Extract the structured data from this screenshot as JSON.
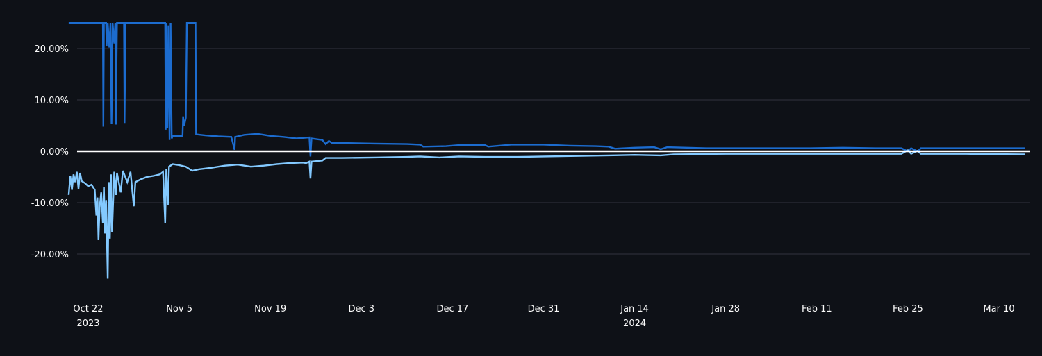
{
  "chart_data": {
    "type": "line",
    "title": "",
    "xlabel": "",
    "ylabel": "",
    "x_range": [
      "2023-10-19",
      "2024-03-14"
    ],
    "ylim": [
      -28,
      27
    ],
    "grid": true,
    "legend": "none",
    "background": "#0e1117",
    "gridline_color": "#31333f",
    "zero_line_color": "#ffffff",
    "y_ticks": [
      {
        "value": 20,
        "label": "20.00%"
      },
      {
        "value": 10,
        "label": "10.00%"
      },
      {
        "value": 0,
        "label": "0.00%"
      },
      {
        "value": -10,
        "label": "-10.00%"
      },
      {
        "value": -20,
        "label": "-20.00%"
      }
    ],
    "x_ticks": [
      {
        "date": "2023-10-22",
        "label": "Oct 22",
        "sublabel": "2023"
      },
      {
        "date": "2023-11-05",
        "label": "Nov 5",
        "sublabel": ""
      },
      {
        "date": "2023-11-19",
        "label": "Nov 19",
        "sublabel": ""
      },
      {
        "date": "2023-12-03",
        "label": "Dec 3",
        "sublabel": ""
      },
      {
        "date": "2023-12-17",
        "label": "Dec 17",
        "sublabel": ""
      },
      {
        "date": "2023-12-31",
        "label": "Dec 31",
        "sublabel": ""
      },
      {
        "date": "2024-01-14",
        "label": "Jan 14",
        "sublabel": "2024"
      },
      {
        "date": "2024-01-28",
        "label": "Jan 28",
        "sublabel": ""
      },
      {
        "date": "2024-02-11",
        "label": "Feb 11",
        "sublabel": ""
      },
      {
        "date": "2024-02-25",
        "label": "Feb 25",
        "sublabel": ""
      },
      {
        "date": "2024-03-10",
        "label": "Mar 10",
        "sublabel": ""
      }
    ],
    "series": [
      {
        "color": "#1c6ccf",
        "points": [
          [
            "2023-10-19 00:00",
            25.0
          ],
          [
            "2023-10-24 06:00",
            25.0
          ],
          [
            "2023-10-24 08:00",
            4.8
          ],
          [
            "2023-10-24 10:00",
            25.0
          ],
          [
            "2023-10-24 18:00",
            25.0
          ],
          [
            "2023-10-24 20:00",
            20.5
          ],
          [
            "2023-10-25 00:00",
            25.0
          ],
          [
            "2023-10-25 06:00",
            20.2
          ],
          [
            "2023-10-25 10:00",
            25.0
          ],
          [
            "2023-10-25 14:00",
            5.3
          ],
          [
            "2023-10-25 18:00",
            25.0
          ],
          [
            "2023-10-26 00:00",
            21.0
          ],
          [
            "2023-10-26 04:00",
            25.0
          ],
          [
            "2023-10-26 06:00",
            5.2
          ],
          [
            "2023-10-26 10:00",
            25.0
          ],
          [
            "2023-10-27 12:00",
            25.0
          ],
          [
            "2023-10-27 14:00",
            5.5
          ],
          [
            "2023-10-27 18:00",
            25.0
          ],
          [
            "2023-11-02 20:00",
            25.0
          ],
          [
            "2023-11-02 22:00",
            4.2
          ],
          [
            "2023-11-03 00:00",
            25.0
          ],
          [
            "2023-11-03 04:00",
            4.5
          ],
          [
            "2023-11-03 08:00",
            24.5
          ],
          [
            "2023-11-03 12:00",
            2.2
          ],
          [
            "2023-11-03 16:00",
            25.0
          ],
          [
            "2023-11-03 20:00",
            2.5
          ],
          [
            "2023-11-04 00:00",
            3.0
          ],
          [
            "2023-11-05 00:00",
            3.0
          ],
          [
            "2023-11-05 12:00",
            3.0
          ],
          [
            "2023-11-05 14:00",
            6.8
          ],
          [
            "2023-11-05 18:00",
            5.0
          ],
          [
            "2023-11-06 00:00",
            6.5
          ],
          [
            "2023-11-06 04:00",
            25.0
          ],
          [
            "2023-11-07 12:00",
            25.0
          ],
          [
            "2023-11-07 14:00",
            3.3
          ],
          [
            "2023-11-09 00:00",
            3.1
          ],
          [
            "2023-11-11 00:00",
            2.9
          ],
          [
            "2023-11-13 00:00",
            2.8
          ],
          [
            "2023-11-13 12:00",
            0.3
          ],
          [
            "2023-11-13 14:00",
            2.8
          ],
          [
            "2023-11-15 00:00",
            3.2
          ],
          [
            "2023-11-17 00:00",
            3.4
          ],
          [
            "2023-11-19 00:00",
            3.0
          ],
          [
            "2023-11-21 00:00",
            2.8
          ],
          [
            "2023-11-23 00:00",
            2.5
          ],
          [
            "2023-11-24 00:00",
            2.6
          ],
          [
            "2023-11-25 00:00",
            2.7
          ],
          [
            "2023-11-25 04:00",
            -1.0
          ],
          [
            "2023-11-25 08:00",
            2.5
          ],
          [
            "2023-11-27 00:00",
            2.2
          ],
          [
            "2023-11-27 12:00",
            1.4
          ],
          [
            "2023-11-28 00:00",
            2.0
          ],
          [
            "2023-11-28 12:00",
            1.6
          ],
          [
            "2023-12-01 00:00",
            1.6
          ],
          [
            "2023-12-05 00:00",
            1.5
          ],
          [
            "2023-12-10 00:00",
            1.4
          ],
          [
            "2023-12-12 00:00",
            1.3
          ],
          [
            "2023-12-12 12:00",
            0.9
          ],
          [
            "2023-12-16 00:00",
            1.0
          ],
          [
            "2023-12-18 00:00",
            1.2
          ],
          [
            "2023-12-22 00:00",
            1.2
          ],
          [
            "2023-12-22 12:00",
            0.9
          ],
          [
            "2023-12-26 00:00",
            1.3
          ],
          [
            "2023-12-31 00:00",
            1.3
          ],
          [
            "2024-01-04 00:00",
            1.1
          ],
          [
            "2024-01-08 00:00",
            1.0
          ],
          [
            "2024-01-10 00:00",
            0.9
          ],
          [
            "2024-01-11 00:00",
            0.5
          ],
          [
            "2024-01-14 00:00",
            0.7
          ],
          [
            "2024-01-17 00:00",
            0.8
          ],
          [
            "2024-01-18 00:00",
            0.4
          ],
          [
            "2024-01-19 00:00",
            0.8
          ],
          [
            "2024-01-25 00:00",
            0.6
          ],
          [
            "2024-02-01 00:00",
            0.6
          ],
          [
            "2024-02-10 00:00",
            0.6
          ],
          [
            "2024-02-15 00:00",
            0.7
          ],
          [
            "2024-02-20 00:00",
            0.6
          ],
          [
            "2024-02-24 00:00",
            0.6
          ],
          [
            "2024-02-25 00:00",
            0.0
          ],
          [
            "2024-02-25 12:00",
            0.6
          ],
          [
            "2024-02-26 12:00",
            0.0
          ],
          [
            "2024-02-27 00:00",
            0.6
          ],
          [
            "2024-03-03 00:00",
            0.6
          ],
          [
            "2024-03-14 00:00",
            0.6
          ]
        ]
      },
      {
        "color": "#83c9ff",
        "points": [
          [
            "2023-10-19 00:00",
            -8.5
          ],
          [
            "2023-10-19 06:00",
            -4.8
          ],
          [
            "2023-10-19 12:00",
            -7.5
          ],
          [
            "2023-10-19 18:00",
            -4.5
          ],
          [
            "2023-10-20 00:00",
            -6.0
          ],
          [
            "2023-10-20 06:00",
            -4.0
          ],
          [
            "2023-10-20 12:00",
            -7.3
          ],
          [
            "2023-10-20 18:00",
            -4.2
          ],
          [
            "2023-10-21 00:00",
            -5.8
          ],
          [
            "2023-10-21 12:00",
            -6.2
          ],
          [
            "2023-10-22 00:00",
            -6.8
          ],
          [
            "2023-10-22 12:00",
            -6.5
          ],
          [
            "2023-10-23 00:00",
            -7.5
          ],
          [
            "2023-10-23 06:00",
            -12.5
          ],
          [
            "2023-10-23 10:00",
            -9.0
          ],
          [
            "2023-10-23 14:00",
            -17.3
          ],
          [
            "2023-10-23 18:00",
            -11.0
          ],
          [
            "2023-10-24 00:00",
            -8.0
          ],
          [
            "2023-10-24 06:00",
            -14.0
          ],
          [
            "2023-10-24 10:00",
            -7.0
          ],
          [
            "2023-10-24 14:00",
            -16.0
          ],
          [
            "2023-10-24 18:00",
            -9.5
          ],
          [
            "2023-10-25 00:00",
            -24.8
          ],
          [
            "2023-10-25 04:00",
            -6.0
          ],
          [
            "2023-10-25 08:00",
            -17.0
          ],
          [
            "2023-10-25 12:00",
            -4.5
          ],
          [
            "2023-10-25 16:00",
            -15.8
          ],
          [
            "2023-10-26 00:00",
            -4.0
          ],
          [
            "2023-10-26 06:00",
            -8.5
          ],
          [
            "2023-10-26 10:00",
            -4.2
          ],
          [
            "2023-10-27 00:00",
            -8.0
          ],
          [
            "2023-10-27 08:00",
            -3.8
          ],
          [
            "2023-10-28 00:00",
            -6.0
          ],
          [
            "2023-10-28 12:00",
            -4.0
          ],
          [
            "2023-10-29 00:00",
            -10.7
          ],
          [
            "2023-10-29 06:00",
            -6.0
          ],
          [
            "2023-10-30 00:00",
            -5.5
          ],
          [
            "2023-10-31 00:00",
            -5.0
          ],
          [
            "2023-11-01 00:00",
            -4.8
          ],
          [
            "2023-11-02 00:00",
            -4.5
          ],
          [
            "2023-11-02 12:00",
            -4.0
          ],
          [
            "2023-11-02 20:00",
            -14.0
          ],
          [
            "2023-11-03 00:00",
            -3.5
          ],
          [
            "2023-11-03 06:00",
            -10.5
          ],
          [
            "2023-11-03 10:00",
            -3.0
          ],
          [
            "2023-11-04 00:00",
            -2.5
          ],
          [
            "2023-11-05 00:00",
            -2.7
          ],
          [
            "2023-11-06 00:00",
            -3.0
          ],
          [
            "2023-11-07 00:00",
            -3.8
          ],
          [
            "2023-11-08 00:00",
            -3.5
          ],
          [
            "2023-11-10 00:00",
            -3.2
          ],
          [
            "2023-11-12 00:00",
            -2.8
          ],
          [
            "2023-11-14 00:00",
            -2.6
          ],
          [
            "2023-11-16 00:00",
            -3.0
          ],
          [
            "2023-11-18 00:00",
            -2.8
          ],
          [
            "2023-11-20 00:00",
            -2.5
          ],
          [
            "2023-11-22 00:00",
            -2.3
          ],
          [
            "2023-11-24 00:00",
            -2.2
          ],
          [
            "2023-11-24 12:00",
            -2.3
          ],
          [
            "2023-11-25 00:00",
            -2.0
          ],
          [
            "2023-11-25 04:00",
            -5.3
          ],
          [
            "2023-11-25 08:00",
            -2.0
          ],
          [
            "2023-11-27 00:00",
            -1.8
          ],
          [
            "2023-11-27 12:00",
            -1.3
          ],
          [
            "2023-11-30 00:00",
            -1.3
          ],
          [
            "2023-12-05 00:00",
            -1.2
          ],
          [
            "2023-12-10 00:00",
            -1.1
          ],
          [
            "2023-12-12 00:00",
            -1.0
          ],
          [
            "2023-12-15 00:00",
            -1.2
          ],
          [
            "2023-12-18 00:00",
            -1.0
          ],
          [
            "2023-12-22 00:00",
            -1.1
          ],
          [
            "2023-12-27 00:00",
            -1.1
          ],
          [
            "2023-12-31 00:00",
            -1.0
          ],
          [
            "2024-01-05 00:00",
            -0.9
          ],
          [
            "2024-01-10 00:00",
            -0.8
          ],
          [
            "2024-01-14 00:00",
            -0.7
          ],
          [
            "2024-01-18 00:00",
            -0.8
          ],
          [
            "2024-01-20 00:00",
            -0.6
          ],
          [
            "2024-01-28 00:00",
            -0.5
          ],
          [
            "2024-02-05 00:00",
            -0.5
          ],
          [
            "2024-02-15 00:00",
            -0.5
          ],
          [
            "2024-02-24 00:00",
            -0.5
          ],
          [
            "2024-02-25 00:00",
            0.2
          ],
          [
            "2024-02-25 12:00",
            -0.5
          ],
          [
            "2024-02-26 12:00",
            0.1
          ],
          [
            "2024-02-27 00:00",
            -0.5
          ],
          [
            "2024-03-05 00:00",
            -0.5
          ],
          [
            "2024-03-14 00:00",
            -0.6
          ]
        ]
      }
    ]
  }
}
